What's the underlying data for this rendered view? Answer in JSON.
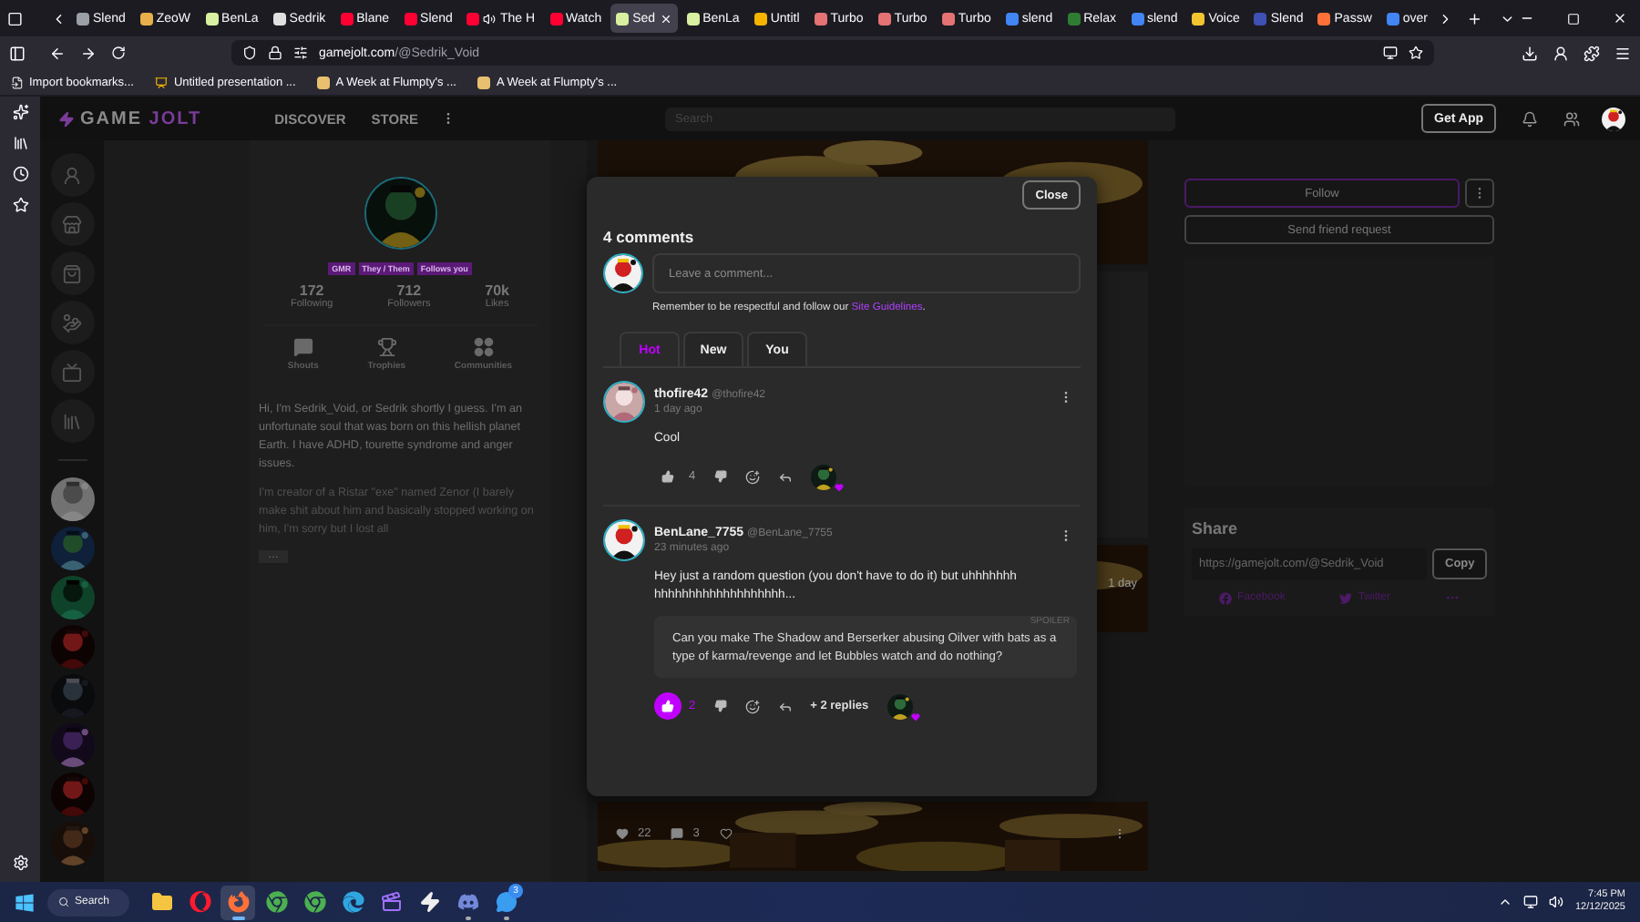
{
  "browser": {
    "tabs": [
      {
        "title": "Slend",
        "color": "#9aa0a6",
        "playing": false,
        "selected": false
      },
      {
        "title": "ZeoW",
        "color": "#e8b04a",
        "playing": false,
        "selected": false
      },
      {
        "title": "BenLa",
        "color": "#d8f0a0",
        "playing": false,
        "selected": false
      },
      {
        "title": "Sedrik",
        "color": "#e0e0e0",
        "playing": false,
        "selected": false
      },
      {
        "title": "Blane",
        "color": "#ff0033",
        "playing": false,
        "selected": false
      },
      {
        "title": "Slend",
        "color": "#ff0033",
        "playing": false,
        "selected": false
      },
      {
        "title": "The H",
        "color": "#ff0033",
        "playing": true,
        "selected": false
      },
      {
        "title": "Watch",
        "color": "#ff0033",
        "playing": false,
        "selected": false
      },
      {
        "title": "Sed",
        "color": "#d8f0a0",
        "playing": false,
        "selected": true
      },
      {
        "title": "BenLa",
        "color": "#d8f0a0",
        "playing": false,
        "selected": false
      },
      {
        "title": "Untitl",
        "color": "#f4b400",
        "playing": false,
        "selected": false
      },
      {
        "title": "Turbo",
        "color": "#e57373",
        "playing": false,
        "selected": false
      },
      {
        "title": "Turbo",
        "color": "#e57373",
        "playing": false,
        "selected": false
      },
      {
        "title": "Turbo",
        "color": "#e57373",
        "playing": false,
        "selected": false
      },
      {
        "title": "slend",
        "color": "#4285f4",
        "playing": false,
        "selected": false
      },
      {
        "title": "Relax",
        "color": "#2e7d32",
        "playing": false,
        "selected": false
      },
      {
        "title": "slend",
        "color": "#4285f4",
        "playing": false,
        "selected": false
      },
      {
        "title": "Voice",
        "color": "#f4c430",
        "playing": false,
        "selected": false
      },
      {
        "title": "Slend",
        "color": "#3f51b5",
        "playing": false,
        "selected": false
      },
      {
        "title": "Passw",
        "color": "#ff7139",
        "playing": false,
        "selected": false
      },
      {
        "title": "over",
        "color": "#4285f4",
        "playing": false,
        "selected": false
      }
    ],
    "address": {
      "host": "gamejolt.com",
      "path": "/@Sedrik_Void"
    },
    "bookmarks": [
      "Import bookmarks...",
      "Untitled presentation ...",
      "A Week at Flumpty's ...",
      "A Week at Flumpty's ..."
    ]
  },
  "header": {
    "logo": [
      "GAME",
      "JOLT"
    ],
    "nav": [
      "DISCOVER",
      "STORE"
    ],
    "search": {
      "placeholder": "Search"
    },
    "get_app": "Get App"
  },
  "profile": {
    "tags": [
      "GMR",
      "They / Them",
      "Follows you"
    ],
    "stats": [
      {
        "value": "172",
        "label": "Following"
      },
      {
        "value": "712",
        "label": "Followers"
      },
      {
        "value": "70k",
        "label": "Likes"
      }
    ],
    "sections": [
      {
        "kind": "shouts",
        "label": "Shouts"
      },
      {
        "kind": "trophies",
        "label": "Trophies"
      },
      {
        "kind": "communities",
        "label": "Communities"
      }
    ],
    "bio": [
      "Hi, I'm Sedrik_Void, or Sedrik shortly I guess. I'm an unfortunate soul that was born on this hellish planet Earth. I have ADHD, tourette syndrome and anger issues.",
      "I'm creator of a Ristar \"exe\" named Zenor (I barely make shit about him and basically stopped working on him, I'm sorry but I lost all"
    ],
    "more": "…"
  },
  "feed": {
    "time": "1 day",
    "likes": "22",
    "comments": "3"
  },
  "actions": {
    "follow": "Follow",
    "friend_request": "Send friend request"
  },
  "share": {
    "title": "Share",
    "url": "https://gamejolt.com/@Sedrik_Void",
    "copy": "Copy",
    "links": [
      {
        "kind": "facebook",
        "label": "Facebook"
      },
      {
        "kind": "twitter",
        "label": "Twitter"
      }
    ]
  },
  "modal": {
    "close": "Close",
    "heading": "4 comments",
    "placeholder": "Leave a comment...",
    "guidelines": "Remember to be respectful and follow our ",
    "guidelines_link": "Site Guidelines",
    "guidelines_end": ".",
    "tabs": [
      {
        "label": "Hot",
        "selected": true
      },
      {
        "label": "New",
        "selected": false
      },
      {
        "label": "You",
        "selected": false
      }
    ],
    "comments": [
      {
        "author": "thofire42",
        "handle": "@thofire42",
        "time": "1 day ago",
        "text": "Cool",
        "likes": "4",
        "liked": false
      },
      {
        "author": "BenLane_7755",
        "handle": "@BenLane_7755",
        "time": "23 minutes ago",
        "text": "Hey just a random question (you don't have to do it) but uhhhhhhhhhhhhhhhhhhhhhhhhhh...",
        "spoiler": {
          "label": "SPOILER",
          "text": "Can you make The Shadow and Berserker abusing Oilver with bats as a type of karma/revenge and let Bubbles watch and do nothing?"
        },
        "likes": "2",
        "liked": true,
        "replies": "+ 2 replies"
      }
    ]
  },
  "taskbar": {
    "search": "Search",
    "apps": [
      {
        "kind": "explorer",
        "active": false,
        "running": false
      },
      {
        "kind": "opera",
        "active": false,
        "running": false
      },
      {
        "kind": "firefox",
        "active": true,
        "running": true
      },
      {
        "kind": "chrome",
        "active": false,
        "running": false
      },
      {
        "kind": "chrome",
        "active": false,
        "running": false
      },
      {
        "kind": "edge",
        "active": false,
        "running": false
      },
      {
        "kind": "clapper",
        "active": false,
        "running": false
      },
      {
        "kind": "gamejolt",
        "active": false,
        "running": false
      },
      {
        "kind": "discord",
        "active": false,
        "running": true
      },
      {
        "kind": "chat",
        "active": false,
        "running": true,
        "badge": "3"
      }
    ],
    "time": "7:45 PM",
    "date": "12/12/2025"
  }
}
